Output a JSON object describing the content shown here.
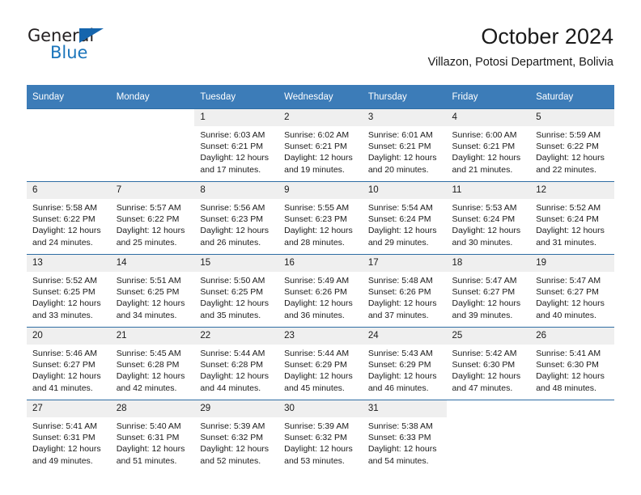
{
  "brand": {
    "name_dark": "General",
    "name_blue": "Blue",
    "accent_color": "#1b75bb",
    "triangle_color": "#1565ad"
  },
  "header": {
    "title": "October 2024",
    "subtitle": "Villazon, Potosi Department, Bolivia"
  },
  "theme": {
    "header_bg": "#3c7cb8",
    "header_text": "#ffffff",
    "row_separator": "#2e6da4",
    "daynum_bg": "#efefef",
    "body_text": "#1a1a1a"
  },
  "calendar": {
    "weekday_headers": [
      "Sunday",
      "Monday",
      "Tuesday",
      "Wednesday",
      "Thursday",
      "Friday",
      "Saturday"
    ],
    "labels": {
      "sunrise": "Sunrise:",
      "sunset": "Sunset:",
      "daylight": "Daylight:"
    },
    "weeks": [
      [
        {
          "day": "",
          "sunrise": "",
          "sunset": "",
          "daylight": ""
        },
        {
          "day": "",
          "sunrise": "",
          "sunset": "",
          "daylight": ""
        },
        {
          "day": "1",
          "sunrise": "Sunrise: 6:03 AM",
          "sunset": "Sunset: 6:21 PM",
          "daylight": "Daylight: 12 hours and 17 minutes."
        },
        {
          "day": "2",
          "sunrise": "Sunrise: 6:02 AM",
          "sunset": "Sunset: 6:21 PM",
          "daylight": "Daylight: 12 hours and 19 minutes."
        },
        {
          "day": "3",
          "sunrise": "Sunrise: 6:01 AM",
          "sunset": "Sunset: 6:21 PM",
          "daylight": "Daylight: 12 hours and 20 minutes."
        },
        {
          "day": "4",
          "sunrise": "Sunrise: 6:00 AM",
          "sunset": "Sunset: 6:21 PM",
          "daylight": "Daylight: 12 hours and 21 minutes."
        },
        {
          "day": "5",
          "sunrise": "Sunrise: 5:59 AM",
          "sunset": "Sunset: 6:22 PM",
          "daylight": "Daylight: 12 hours and 22 minutes."
        }
      ],
      [
        {
          "day": "6",
          "sunrise": "Sunrise: 5:58 AM",
          "sunset": "Sunset: 6:22 PM",
          "daylight": "Daylight: 12 hours and 24 minutes."
        },
        {
          "day": "7",
          "sunrise": "Sunrise: 5:57 AM",
          "sunset": "Sunset: 6:22 PM",
          "daylight": "Daylight: 12 hours and 25 minutes."
        },
        {
          "day": "8",
          "sunrise": "Sunrise: 5:56 AM",
          "sunset": "Sunset: 6:23 PM",
          "daylight": "Daylight: 12 hours and 26 minutes."
        },
        {
          "day": "9",
          "sunrise": "Sunrise: 5:55 AM",
          "sunset": "Sunset: 6:23 PM",
          "daylight": "Daylight: 12 hours and 28 minutes."
        },
        {
          "day": "10",
          "sunrise": "Sunrise: 5:54 AM",
          "sunset": "Sunset: 6:24 PM",
          "daylight": "Daylight: 12 hours and 29 minutes."
        },
        {
          "day": "11",
          "sunrise": "Sunrise: 5:53 AM",
          "sunset": "Sunset: 6:24 PM",
          "daylight": "Daylight: 12 hours and 30 minutes."
        },
        {
          "day": "12",
          "sunrise": "Sunrise: 5:52 AM",
          "sunset": "Sunset: 6:24 PM",
          "daylight": "Daylight: 12 hours and 31 minutes."
        }
      ],
      [
        {
          "day": "13",
          "sunrise": "Sunrise: 5:52 AM",
          "sunset": "Sunset: 6:25 PM",
          "daylight": "Daylight: 12 hours and 33 minutes."
        },
        {
          "day": "14",
          "sunrise": "Sunrise: 5:51 AM",
          "sunset": "Sunset: 6:25 PM",
          "daylight": "Daylight: 12 hours and 34 minutes."
        },
        {
          "day": "15",
          "sunrise": "Sunrise: 5:50 AM",
          "sunset": "Sunset: 6:25 PM",
          "daylight": "Daylight: 12 hours and 35 minutes."
        },
        {
          "day": "16",
          "sunrise": "Sunrise: 5:49 AM",
          "sunset": "Sunset: 6:26 PM",
          "daylight": "Daylight: 12 hours and 36 minutes."
        },
        {
          "day": "17",
          "sunrise": "Sunrise: 5:48 AM",
          "sunset": "Sunset: 6:26 PM",
          "daylight": "Daylight: 12 hours and 37 minutes."
        },
        {
          "day": "18",
          "sunrise": "Sunrise: 5:47 AM",
          "sunset": "Sunset: 6:27 PM",
          "daylight": "Daylight: 12 hours and 39 minutes."
        },
        {
          "day": "19",
          "sunrise": "Sunrise: 5:47 AM",
          "sunset": "Sunset: 6:27 PM",
          "daylight": "Daylight: 12 hours and 40 minutes."
        }
      ],
      [
        {
          "day": "20",
          "sunrise": "Sunrise: 5:46 AM",
          "sunset": "Sunset: 6:27 PM",
          "daylight": "Daylight: 12 hours and 41 minutes."
        },
        {
          "day": "21",
          "sunrise": "Sunrise: 5:45 AM",
          "sunset": "Sunset: 6:28 PM",
          "daylight": "Daylight: 12 hours and 42 minutes."
        },
        {
          "day": "22",
          "sunrise": "Sunrise: 5:44 AM",
          "sunset": "Sunset: 6:28 PM",
          "daylight": "Daylight: 12 hours and 44 minutes."
        },
        {
          "day": "23",
          "sunrise": "Sunrise: 5:44 AM",
          "sunset": "Sunset: 6:29 PM",
          "daylight": "Daylight: 12 hours and 45 minutes."
        },
        {
          "day": "24",
          "sunrise": "Sunrise: 5:43 AM",
          "sunset": "Sunset: 6:29 PM",
          "daylight": "Daylight: 12 hours and 46 minutes."
        },
        {
          "day": "25",
          "sunrise": "Sunrise: 5:42 AM",
          "sunset": "Sunset: 6:30 PM",
          "daylight": "Daylight: 12 hours and 47 minutes."
        },
        {
          "day": "26",
          "sunrise": "Sunrise: 5:41 AM",
          "sunset": "Sunset: 6:30 PM",
          "daylight": "Daylight: 12 hours and 48 minutes."
        }
      ],
      [
        {
          "day": "27",
          "sunrise": "Sunrise: 5:41 AM",
          "sunset": "Sunset: 6:31 PM",
          "daylight": "Daylight: 12 hours and 49 minutes."
        },
        {
          "day": "28",
          "sunrise": "Sunrise: 5:40 AM",
          "sunset": "Sunset: 6:31 PM",
          "daylight": "Daylight: 12 hours and 51 minutes."
        },
        {
          "day": "29",
          "sunrise": "Sunrise: 5:39 AM",
          "sunset": "Sunset: 6:32 PM",
          "daylight": "Daylight: 12 hours and 52 minutes."
        },
        {
          "day": "30",
          "sunrise": "Sunrise: 5:39 AM",
          "sunset": "Sunset: 6:32 PM",
          "daylight": "Daylight: 12 hours and 53 minutes."
        },
        {
          "day": "31",
          "sunrise": "Sunrise: 5:38 AM",
          "sunset": "Sunset: 6:33 PM",
          "daylight": "Daylight: 12 hours and 54 minutes."
        },
        {
          "day": "",
          "sunrise": "",
          "sunset": "",
          "daylight": ""
        },
        {
          "day": "",
          "sunrise": "",
          "sunset": "",
          "daylight": ""
        }
      ]
    ]
  }
}
